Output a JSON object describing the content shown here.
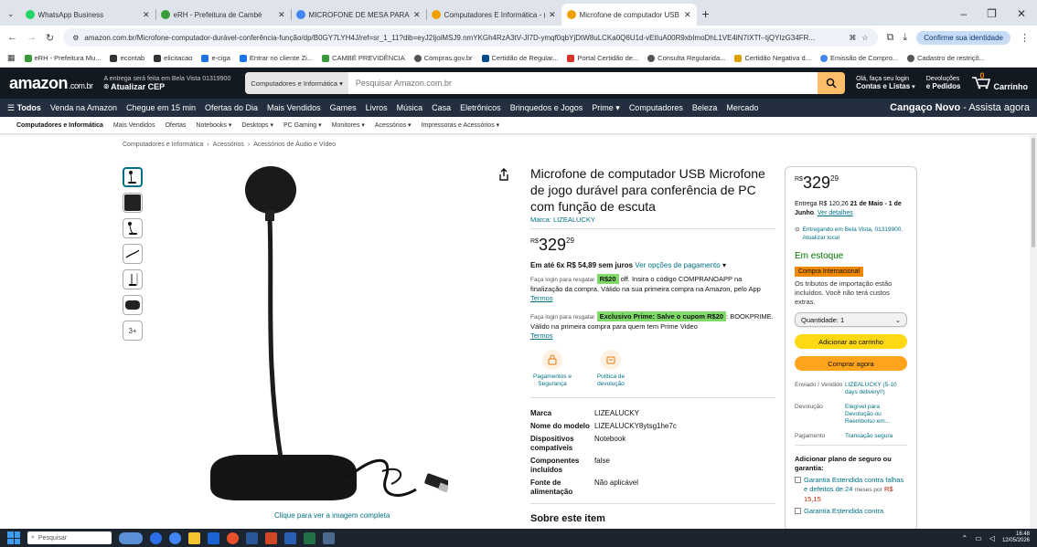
{
  "browser": {
    "tabs": [
      {
        "label": "WhatsApp Business",
        "color": "#25d366"
      },
      {
        "label": "eRH - Prefeitura de Cambé",
        "color": "#3a9b3a"
      },
      {
        "label": "MICROFONE DE MESA PARA C(",
        "color": "#4285f4"
      },
      {
        "label": "Computadores E Informática - (",
        "color": "#f0a000"
      },
      {
        "label": "Microfone de computador USB",
        "color": "#f0a000"
      }
    ],
    "url": "amazon.com.br/Microfone-computador-durável-conferência-função/dp/B0GY7LYH4J/ref=sr_1_11?dib=eyJ2IjoiMSJ9.nmYKGh4RzA3tV-JI7D-ymqf0qbYjDtW8uLCKa0Q6U1d-vEtIuA00R9xbImoDhL1VE4lN7IXTf--tjQYIzG34FR...",
    "identity_label": "Confirme sua identidade",
    "bookmarks": [
      {
        "label": "eRH - Prefeitura Mu...",
        "color": "#3a9b3a"
      },
      {
        "label": "econtab",
        "color": "#333"
      },
      {
        "label": "elicitacao",
        "color": "#333"
      },
      {
        "label": "e-ciga",
        "color": "#1a73e8"
      },
      {
        "label": "Entrar no cliente Zi...",
        "color": "#1a73e8"
      },
      {
        "label": "CAMBÉ PREVIDÊNCIA",
        "color": "#3a9b3a"
      },
      {
        "label": "Compras.gov.br",
        "color": "#555"
      },
      {
        "label": "Certidão de Regular...",
        "color": "#004a8f"
      },
      {
        "label": "Portal Certidão de...",
        "color": "#d93025"
      },
      {
        "label": "Consulta Regularida...",
        "color": "#555"
      },
      {
        "label": "Certidão Negativa d...",
        "color": "#e0a000"
      },
      {
        "label": "Emissão de Compro...",
        "color": "#4285f4"
      },
      {
        "label": "Cadastro de restriçõ...",
        "color": "#555"
      }
    ]
  },
  "header": {
    "logo": "amazon",
    "logo_suffix": ".com.br",
    "deliver_line1": "A entrega será feita em Bela Vista 01319900",
    "deliver_line2": "Atualizar CEP",
    "search_category": "Computadores e Informática",
    "search_placeholder": "Pesquisar Amazon.com.br",
    "account_line1": "Olá, faça seu login",
    "account_line2": "Contas e Listas",
    "returns_line1": "Devoluções",
    "returns_line2": "e Pedidos",
    "cart_count": "0",
    "cart_label": "Carrinho"
  },
  "nav": {
    "items": [
      "Todos",
      "Venda na Amazon",
      "Chegue em 15 min",
      "Ofertas do Dia",
      "Mais Vendidos",
      "Games",
      "Livros",
      "Música",
      "Casa",
      "Eletrônicos",
      "Brinquedos e Jogos",
      "Prime",
      "Computadores",
      "Beleza",
      "Mercado"
    ],
    "promo_bold": "Cangaço Novo",
    "promo_rest": " - Assista agora"
  },
  "subnav": [
    "Computadores e Informática",
    "Mais Vendidos",
    "Ofertas",
    "Notebooks",
    "Desktops",
    "PC Gaming",
    "Monitores",
    "Acessórios",
    "Impressoras e Acessórios"
  ],
  "breadcrumb": [
    "Computadores e Informática",
    "Acessórios",
    "Acessórios de Áudio e Vídeo"
  ],
  "thumbs_more": "3+",
  "image_caption": "Clique para ver a imagem completa",
  "product": {
    "title": "Microfone de computador USB Microfone de jogo durável para conferência de PC com função de escuta",
    "brand_line": "Marca: LIZEALUCKY",
    "price_currency": "R$",
    "price_whole": "329",
    "price_cents": "29",
    "installment_bold": "Em até 6x R$ 54,89 sem juros",
    "installment_link": "Ver opções de pagamento",
    "coupon1_small": "Faça login para resgatar",
    "coupon1_badge": "R$20",
    "coupon1_text": "off. Insira o código COMPRANOAPP na finalização da compra. Válido na sua primeira compra na Amazon, pelo App",
    "coupon1_link": "Termos",
    "coupon2_small": "Faça login para resgatar",
    "coupon2_badge": "Exclusivo Prime: Salve o cupom R$20",
    "coupon2_text": ": BOOKPRIME. Válido na primeira compra para quem tem Prime Video",
    "coupon2_link": "Termos",
    "feature1": "Pagamentos e Segurança",
    "feature2": "Política de devolução",
    "specs": [
      {
        "k": "Marca",
        "v": "LIZEALUCKY"
      },
      {
        "k": "Nome do modelo",
        "v": "LIZEALUCKY8ytsg1he7c"
      },
      {
        "k": "Dispositivos compatíveis",
        "v": "Notebook"
      },
      {
        "k": "Componentes incluídos",
        "v": "false"
      },
      {
        "k": "Fonte de alimentação",
        "v": "Não aplicável"
      }
    ],
    "about": "Sobre este item"
  },
  "buybox": {
    "price_currency": "R$",
    "price_whole": "329",
    "price_cents": "29",
    "delivery_prefix": "Entrega R$ 120,26",
    "delivery_date": "21 de Maio - 1 de Junho",
    "delivery_link": "Ver detalhes",
    "location": "Entregando em Bela Vista, 01319900. Atualizar local",
    "stock": "Em estoque",
    "intl_badge": "Compra Internacional",
    "tax_text": "Os tributos de importação estão incluídos. Você não terá custos extras.",
    "qty_label": "Quantidade: 1",
    "add_to_cart": "Adicionar ao carrinho",
    "buy_now": "Comprar agora",
    "rows": [
      {
        "k": "Enviado / Vendido",
        "v": "LIZEALUCKY (5-10 days delivery!!)"
      },
      {
        "k": "Devolução",
        "v": "Elegível para Devolução ou Reembolso em..."
      },
      {
        "k": "Pagamento",
        "v": "Transação segura"
      }
    ],
    "protect_title": "Adicionar plano de seguro ou garantia:",
    "plan1": "Garantia Estendida contra falhas e defeitos de 24",
    "plan1_small": "meses por",
    "plan1_price": "R$ 15,15",
    "plan2": "Garantia Estendida contra"
  },
  "taskbar": {
    "search_label": "Pesquisar",
    "time": "16:48",
    "date": "12/05/2026"
  }
}
